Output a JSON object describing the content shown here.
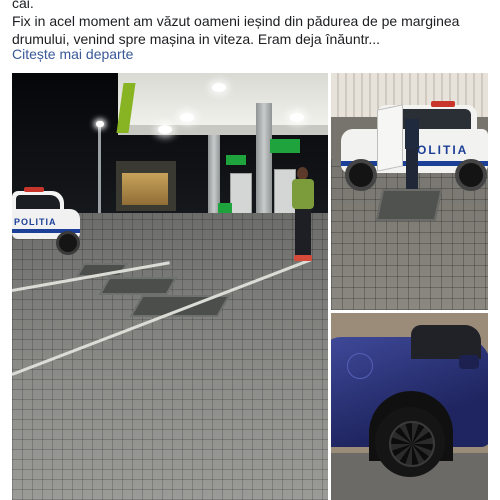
{
  "post": {
    "text_lines": [
      "cai.",
      "Fix in acel moment am văzut oameni ieșind din pădurea de pe marginea",
      "drumului, venind spre mașina in viteza. Eram deja înăuntr..."
    ],
    "see_more_label": "Citește mai departe"
  },
  "photos": {
    "main": {
      "car_label": "POLITIA"
    },
    "top_right": {
      "car_label": "POLITIA"
    },
    "bottom_right": {}
  },
  "colors": {
    "text": "#1c1e21",
    "link": "#385898",
    "police_blue": "#1c3f97",
    "station_green": "#1fa33d"
  }
}
